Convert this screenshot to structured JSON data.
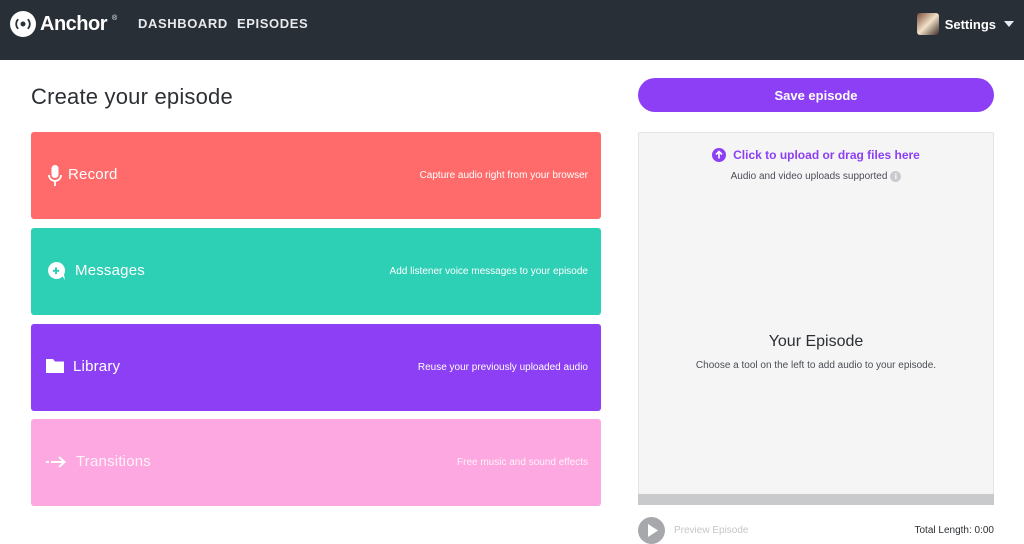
{
  "nav": {
    "brand": "Anchor",
    "brand_mark": "®",
    "links": [
      "DASHBOARD",
      "EPISODES"
    ],
    "settings_label": "Settings",
    "brand_icon": "anchor-logo-icon",
    "dropdown_icon": "caret-down-icon"
  },
  "page": {
    "title": "Create your episode"
  },
  "tools": [
    {
      "label": "Record",
      "description": "Capture audio right from your browser",
      "icon": "microphone-icon",
      "color": "#ff6b6b"
    },
    {
      "label": "Messages",
      "description": "Add listener voice messages to your episode",
      "icon": "message-bubble-icon",
      "color": "#2dcfb5"
    },
    {
      "label": "Library",
      "description": "Reuse your previously uploaded audio",
      "icon": "folder-icon",
      "color": "#8c3ff4"
    },
    {
      "label": "Transitions",
      "description": "Free music and sound effects",
      "icon": "arrow-right-icon",
      "color": "#fda8e0"
    }
  ],
  "right": {
    "save_label": "Save episode",
    "upload_link": "Click to upload or drag files here",
    "upload_note": "Audio and video uploads supported",
    "episode_title": "Your Episode",
    "episode_hint": "Choose a tool on the left to add audio to your episode.",
    "preview_label": "Preview Episode",
    "total_length": "Total Length: 0:00"
  },
  "colors": {
    "accent": "#8c3ff4",
    "nav_bg": "#292f36"
  }
}
